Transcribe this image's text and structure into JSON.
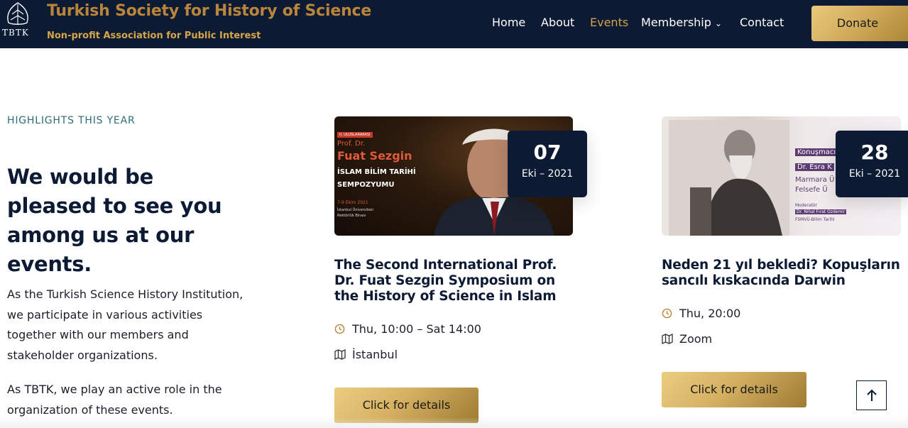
{
  "header": {
    "logo_text": "TBTK",
    "title": "Turkish Society for History of Science",
    "subtitle": "Non-profit Association for Public Interest",
    "nav": {
      "home": "Home",
      "about": "About",
      "events": "Events",
      "membership": "Membership",
      "contact": "Contact"
    },
    "donate_label": "Donate"
  },
  "intro": {
    "eyebrow": "HIGHLIGHTS THIS YEAR",
    "headline": "We would be pleased to see you among us at our events.",
    "paragraph1": "As the Turkish Science History Institution, we participate in various activities together with our members and stakeholder organizations.",
    "paragraph2": "As TBTK, we play an active role in the organization of these events."
  },
  "events": [
    {
      "day": "07",
      "month_year": "Eki – 2021",
      "title": "The Second International Prof. Dr. Fuat Sezgin Symposium on the History of Science in Islam",
      "time": "Thu, 10:00 – Sat 14:00",
      "location": "İstanbul",
      "button": "Click for details",
      "poster": {
        "tag": "II. ULUSLARARASI",
        "prof": "Prof. Dr.",
        "name": "Fuat Sezgin",
        "line1": "İSLAM BİLİM TARİHİ",
        "line2": "SEMPOZYUMU",
        "date": "7-9 Ekim 2021",
        "venue1": "İstanbul Üniversitesi",
        "venue2": "Rektörlük Binası"
      }
    },
    {
      "day": "28",
      "month_year": "Eki – 2021",
      "title": "Neden 21 yıl bekledi? Kopuşların sancılı kıskacında Darwin",
      "time": "Thu, 20:00",
      "location": "Zoom",
      "button": "Click for details",
      "poster": {
        "l1": "Konuşmacı",
        "l2": "Dr. Esra K",
        "l3": "Marmara Ü",
        "l4": "Felsefe Ü",
        "l5": "Moderatör",
        "l6": "Dr. Nihal Fırat Özdemir",
        "l7": "FSMVÜ-Bilim Tarihi"
      }
    }
  ],
  "icons": {
    "clock": "clock-icon",
    "map": "map-icon",
    "arrow_up": "arrow-up-icon",
    "chevron": "chevron-down-icon"
  },
  "colors": {
    "navy": "#0c1a33",
    "gold": "#d2a24c",
    "teal": "#2f6c7a"
  }
}
